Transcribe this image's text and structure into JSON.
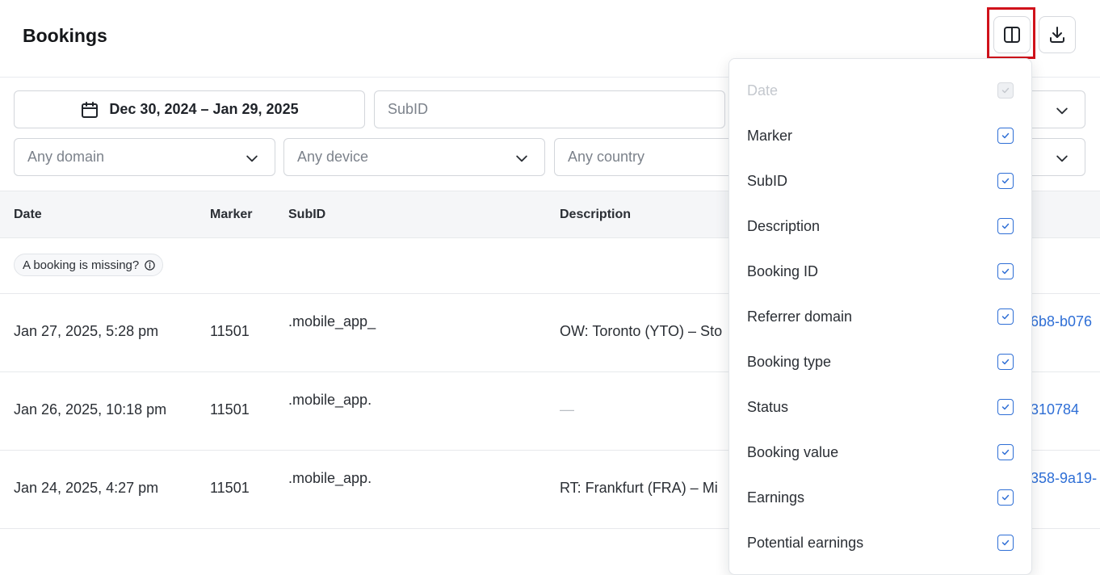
{
  "header": {
    "title": "Bookings"
  },
  "icons": {
    "columns": "columns-icon",
    "download": "download-icon",
    "calendar": "calendar-icon",
    "chevron": "chevron-down-icon",
    "info": "info-icon",
    "check": "check-icon"
  },
  "colors": {
    "accent": "#2f6fd6",
    "highlight": "#d0121b",
    "checkbox_disabled": "#c4c8ce"
  },
  "filters": {
    "date_range": "Dec 30, 2024 – Jan 29, 2025",
    "subid_placeholder": "SubID",
    "domain_placeholder": "Any domain",
    "device_placeholder": "Any device",
    "country_placeholder": "Any country"
  },
  "table": {
    "columns": [
      "Date",
      "Marker",
      "SubID",
      "Description"
    ],
    "missing_label": "A booking is missing?",
    "rows": [
      {
        "date": "Jan 27, 2025, 5:28 pm",
        "marker": "11501",
        "subid": ".mobile_app_",
        "description": "OW: Toronto (YTO) – Sto",
        "id": "6b8-b076"
      },
      {
        "date": "Jan 26, 2025, 10:18 pm",
        "marker": "11501",
        "subid": ".mobile_app.",
        "description": "—",
        "id": "310784"
      },
      {
        "date": "Jan 24, 2025, 4:27 pm",
        "marker": "11501",
        "subid": ".mobile_app.",
        "description": "RT: Frankfurt (FRA) – Mi",
        "id": "358-9a19-"
      }
    ]
  },
  "column_picker": {
    "options": [
      {
        "label": "Date",
        "checked": true,
        "disabled": true
      },
      {
        "label": "Marker",
        "checked": true,
        "disabled": false
      },
      {
        "label": "SubID",
        "checked": true,
        "disabled": false
      },
      {
        "label": "Description",
        "checked": true,
        "disabled": false
      },
      {
        "label": "Booking ID",
        "checked": true,
        "disabled": false
      },
      {
        "label": "Referrer domain",
        "checked": true,
        "disabled": false
      },
      {
        "label": "Booking type",
        "checked": true,
        "disabled": false
      },
      {
        "label": "Status",
        "checked": true,
        "disabled": false
      },
      {
        "label": "Booking value",
        "checked": true,
        "disabled": false
      },
      {
        "label": "Earnings",
        "checked": true,
        "disabled": false
      },
      {
        "label": "Potential earnings",
        "checked": true,
        "disabled": false
      }
    ]
  }
}
